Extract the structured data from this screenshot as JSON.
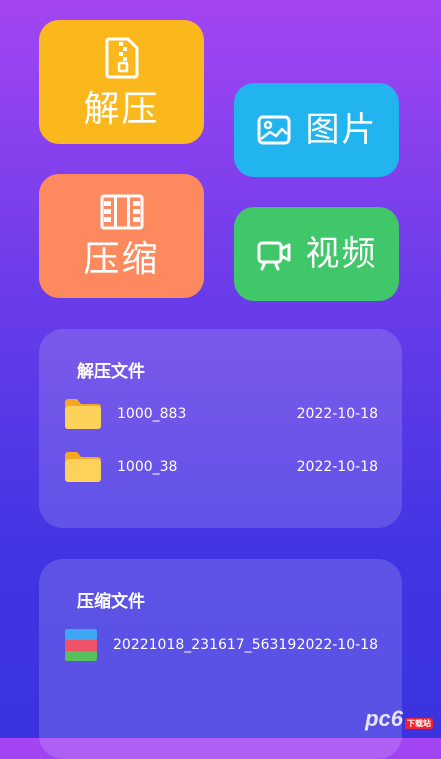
{
  "tiles": {
    "unzip": {
      "label": "解压",
      "icon": "zip-file-icon",
      "color": "#fbb81c"
    },
    "compress": {
      "label": "压缩",
      "icon": "film-strip-icon",
      "color": "#fd8a5e"
    },
    "image": {
      "label": "图片",
      "icon": "image-icon",
      "color": "#22b4ef"
    },
    "video": {
      "label": "视频",
      "icon": "video-camera-icon",
      "color": "#3fc76a"
    }
  },
  "unzipped_files": {
    "title": "解压文件",
    "items": [
      {
        "name": "1000_883",
        "date": "2022-10-18",
        "icon": "folder-icon"
      },
      {
        "name": "1000_38",
        "date": "2022-10-18",
        "icon": "folder-icon"
      }
    ]
  },
  "compressed_files": {
    "title": "压缩文件",
    "items": [
      {
        "name": "20221018_231617_56319",
        "date": "2022-10-18",
        "icon": "rar-archive-icon"
      }
    ]
  },
  "watermark": {
    "main": "pc6",
    "small": "下载站"
  }
}
